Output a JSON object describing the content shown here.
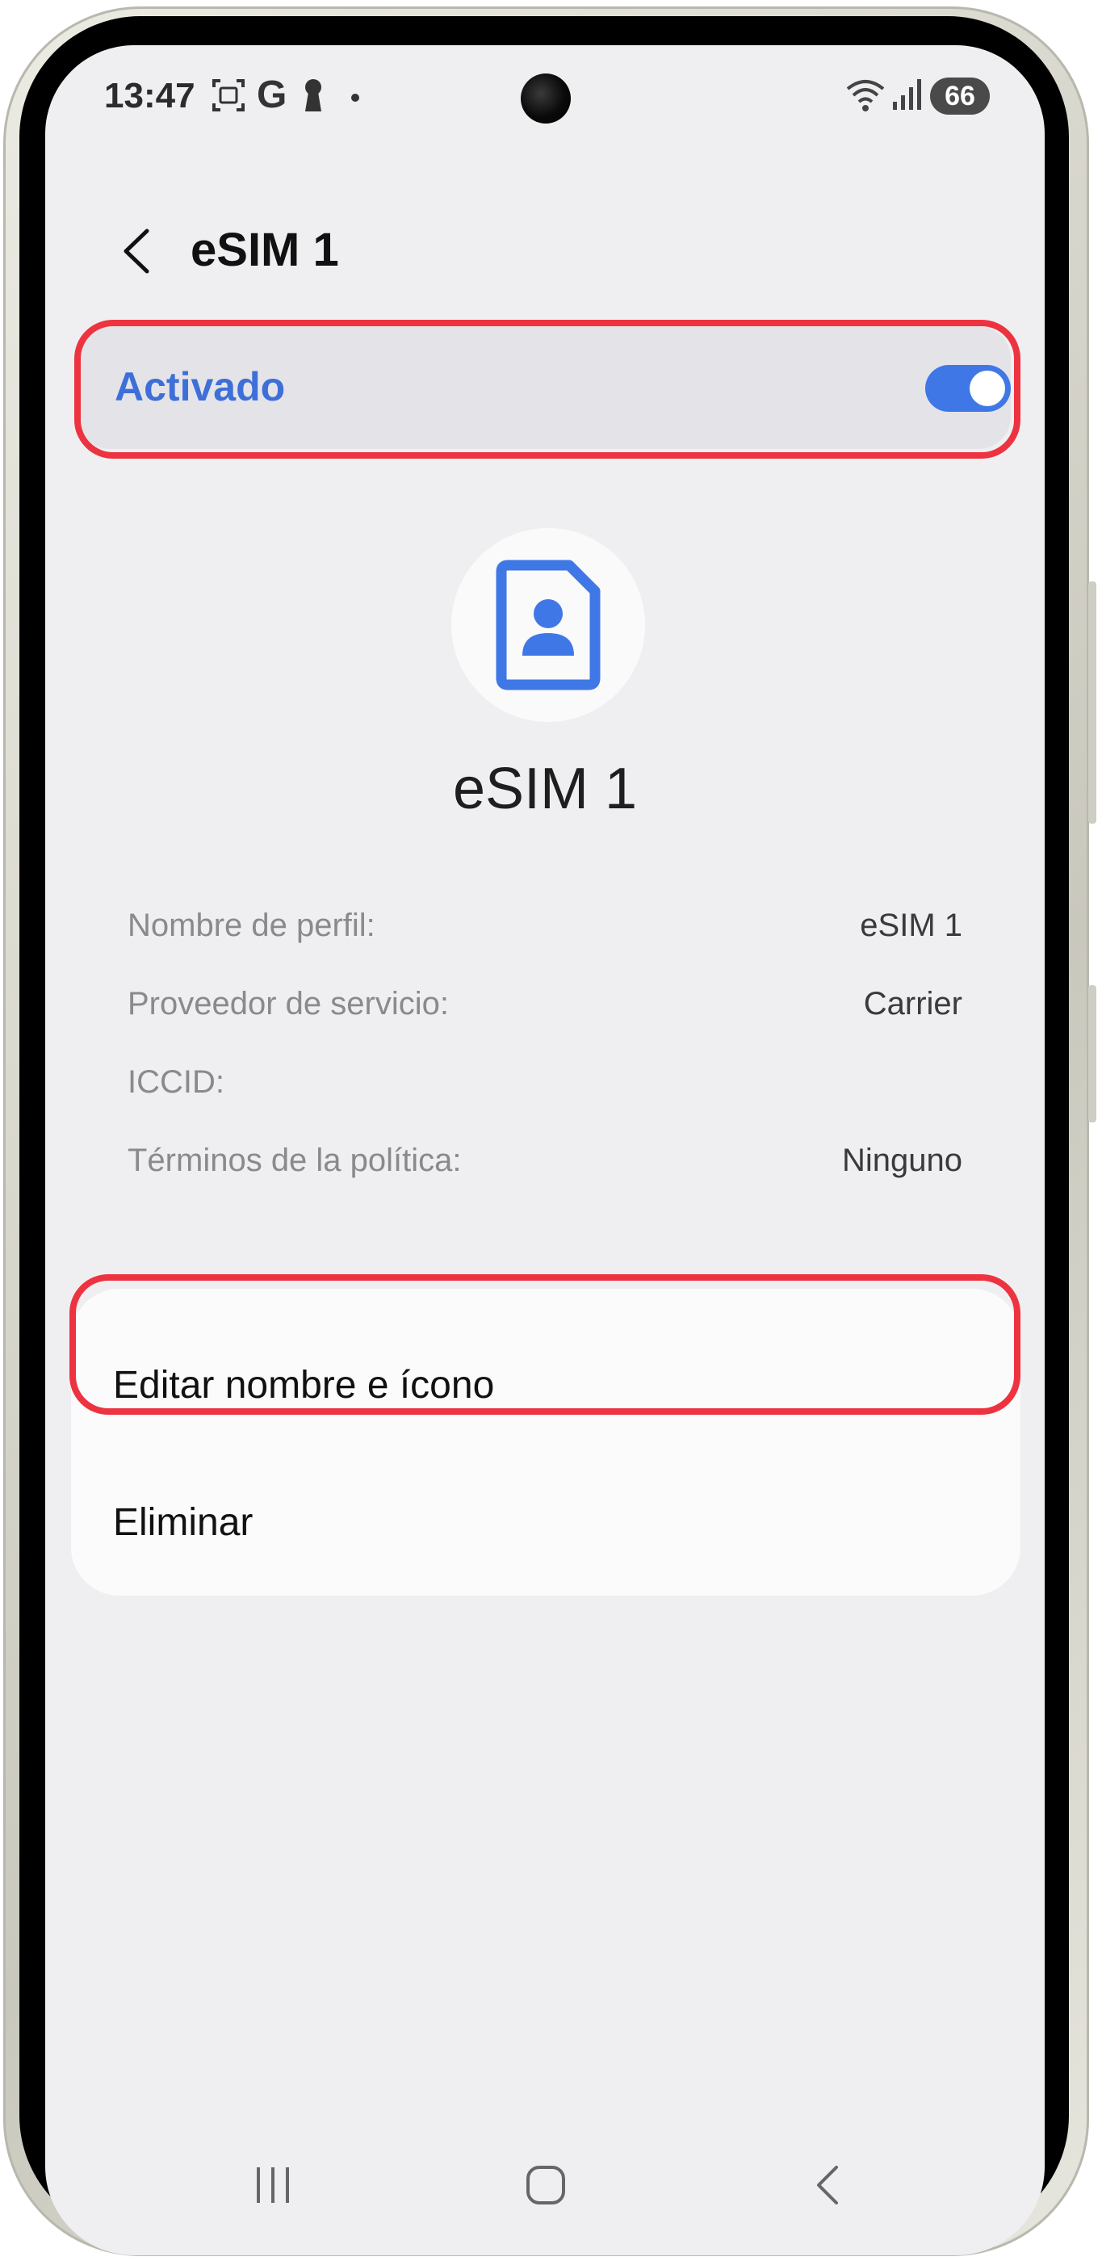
{
  "status_bar": {
    "time": "13:47",
    "battery": "66",
    "icons": [
      "screenshot-icon",
      "google-icon",
      "keyhole-icon",
      "dot-icon",
      "wifi-icon",
      "signal-icon"
    ]
  },
  "header": {
    "title": "eSIM 1",
    "back_icon": "chevron-left-icon"
  },
  "toggle": {
    "label": "Activado",
    "state": "on",
    "accent_color": "#3e6fd8"
  },
  "profile": {
    "icon": "sim-contact-icon",
    "name": "eSIM 1"
  },
  "info": [
    {
      "label": "Nombre de perfil:",
      "value": "eSIM 1"
    },
    {
      "label": "Proveedor de servicio:",
      "value": "Carrier"
    },
    {
      "label": "ICCID:",
      "value": ""
    },
    {
      "label": "Términos de la política:",
      "value": "Ninguno"
    }
  ],
  "actions": {
    "edit": "Editar nombre e ícono",
    "delete": "Eliminar"
  },
  "navigation": {
    "icons": [
      "recent-apps-icon",
      "home-icon",
      "back-icon"
    ]
  },
  "highlight_color": "#ee3340"
}
